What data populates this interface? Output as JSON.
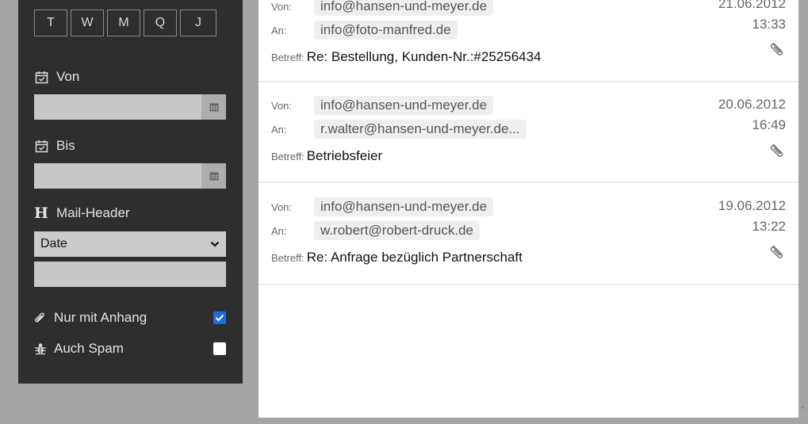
{
  "filters": {
    "range_buttons": [
      "T",
      "W",
      "M",
      "Q",
      "J"
    ],
    "von_label": "Von",
    "von_value": "",
    "bis_label": "Bis",
    "bis_value": "",
    "header_label": "Mail-Header",
    "header_icon_glyph": "H",
    "header_select_value": "Date",
    "header_value": "",
    "attachment_label": "Nur mit Anhang",
    "attachment_checked": true,
    "spam_label": "Auch Spam",
    "spam_checked": false
  },
  "mail_labels": {
    "from": "Von:",
    "to": "An:",
    "subject": "Betreff:"
  },
  "mails": [
    {
      "from": "info@hansen-und-meyer.de",
      "to": "info@foto-manfred.de",
      "subject": "Re: Bestellung, Kunden-Nr.:#25256434",
      "date": "21.06.2012",
      "time": "13:33"
    },
    {
      "from": "info@hansen-und-meyer.de",
      "to": "r.walter@hansen-und-meyer.de...",
      "subject": "Betriebsfeier",
      "date": "20.06.2012",
      "time": "16:49"
    },
    {
      "from": "info@hansen-und-meyer.de",
      "to": "w.robert@robert-druck.de",
      "subject": "Re: Anfrage bezüglich Partnerschaft",
      "date": "19.06.2012",
      "time": "13:22"
    }
  ],
  "colors": {
    "sidebar_bg": "#2e2e2e",
    "page_bg": "#a4a4a4",
    "checkbox_accent": "#1d6de0"
  }
}
